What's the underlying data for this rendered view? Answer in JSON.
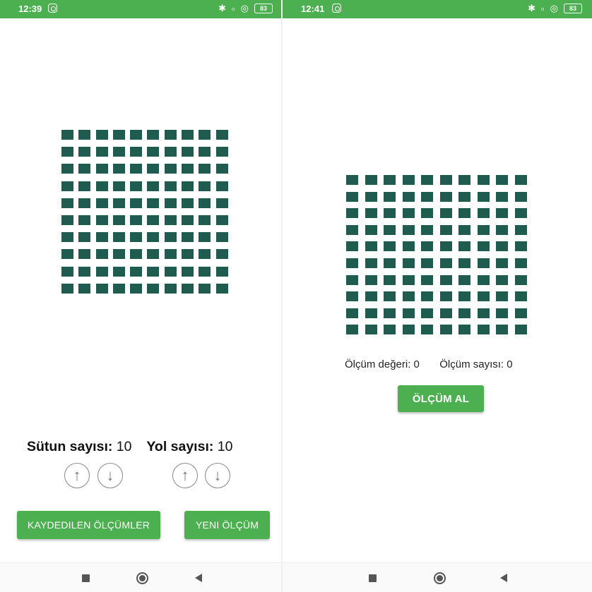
{
  "left_screen": {
    "status": {
      "time": "12:39",
      "battery": "83"
    },
    "grid": {
      "columns": 10,
      "rows": 10,
      "cell_color": "#1f5b4f"
    },
    "counts": {
      "column_label": "Sütun sayısı:",
      "column_value": "10",
      "row_label": "Yol sayısı:",
      "row_value": "10"
    },
    "arrows": {
      "up": "↑",
      "down": "↓"
    },
    "buttons": {
      "saved": "KAYDEDILEN ÖLÇÜMLER",
      "new": "YENI ÖLÇÜM"
    }
  },
  "right_screen": {
    "status": {
      "time": "12:41",
      "battery": "83"
    },
    "grid": {
      "columns": 10,
      "rows": 10,
      "cell_color": "#1f5b4f"
    },
    "measure_value_text": "Ölçüm değeri: 0",
    "measure_count_text": "Ölçüm sayısı: 0",
    "measure_button": "ÖLÇÜM AL"
  },
  "icons": [
    "instagram-icon",
    "bluetooth-icon",
    "signal-icon",
    "wifi-icon",
    "battery-icon",
    "arrow-up-icon",
    "arrow-down-icon",
    "nav-recent-icon",
    "nav-home-icon",
    "nav-back-icon"
  ],
  "colors": {
    "accent": "#4caf50",
    "grid_cell": "#1f5b4f"
  }
}
